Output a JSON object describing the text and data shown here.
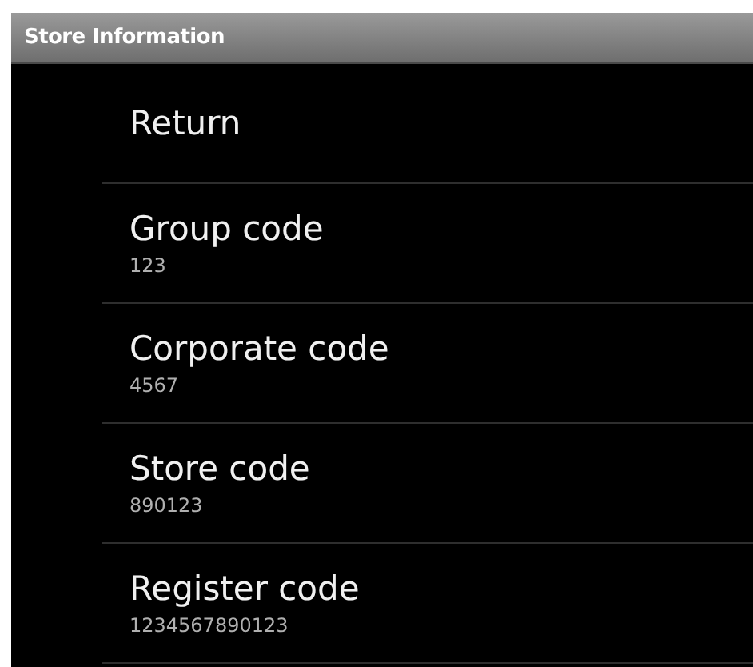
{
  "window": {
    "title": "Store Information"
  },
  "items": [
    {
      "title": "Return"
    },
    {
      "title": "Group code",
      "value": "123"
    },
    {
      "title": "Corporate code",
      "value": "4567"
    },
    {
      "title": "Store code",
      "value": "890123"
    },
    {
      "title": "Register code",
      "value": "1234567890123"
    }
  ]
}
